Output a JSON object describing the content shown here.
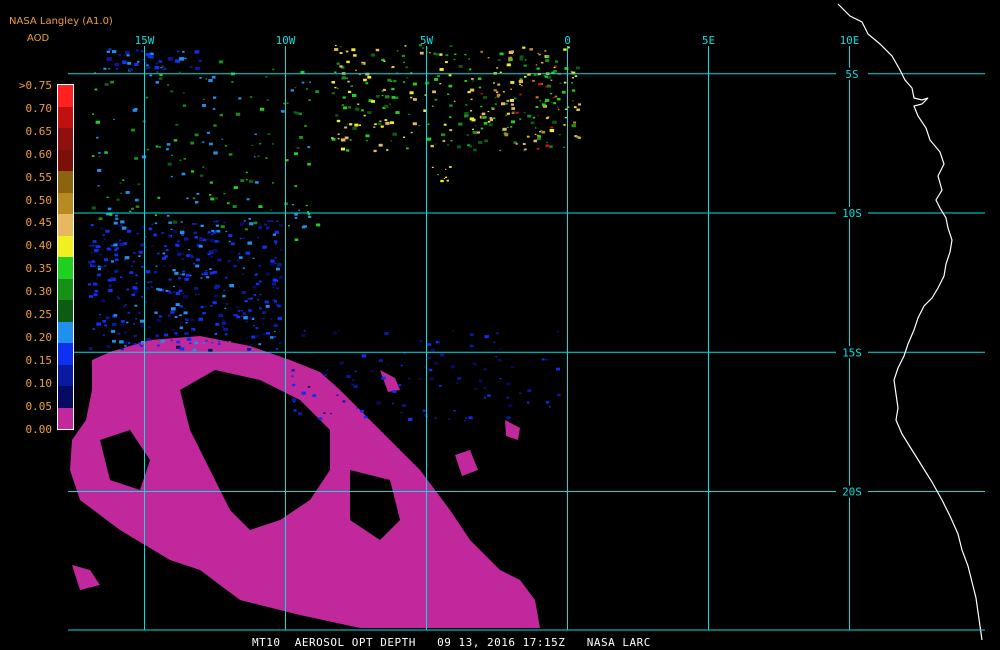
{
  "header": {
    "title": "NASA Langley (A1.0)",
    "variable": "AOD"
  },
  "legend": [
    {
      "label": ">0.75",
      "color": "#ff2020"
    },
    {
      "label": "0.70",
      "color": "#c01010"
    },
    {
      "label": "0.65",
      "color": "#901010"
    },
    {
      "label": "0.60",
      "color": "#7a1008"
    },
    {
      "label": "0.55",
      "color": "#8c6410"
    },
    {
      "label": "0.50",
      "color": "#b88a20"
    },
    {
      "label": "0.45",
      "color": "#e8b860"
    },
    {
      "label": "0.40",
      "color": "#f0f020"
    },
    {
      "label": "0.35",
      "color": "#20d020"
    },
    {
      "label": "0.30",
      "color": "#169016"
    },
    {
      "label": "0.25",
      "color": "#0c5c14"
    },
    {
      "label": "0.20",
      "color": "#2090f0"
    },
    {
      "label": "0.15",
      "color": "#1030f0"
    },
    {
      "label": "0.10",
      "color": "#0a1aa0"
    },
    {
      "label": "0.05",
      "color": "#060a60"
    },
    {
      "label": "0.00",
      "color": "#c0289c"
    }
  ],
  "map": {
    "gridline_color": "#00e0e0",
    "coastline_color": "#ffffff",
    "longitudes": [
      {
        "label": "15W",
        "value": -15
      },
      {
        "label": "10W",
        "value": -10
      },
      {
        "label": "5W",
        "value": -5
      },
      {
        "label": "0",
        "value": 0
      },
      {
        "label": "5E",
        "value": 5
      },
      {
        "label": "10E",
        "value": 10
      }
    ],
    "latitudes": [
      {
        "label": "5S",
        "value": -5
      },
      {
        "label": "10S",
        "value": -10
      },
      {
        "label": "15S",
        "value": -15
      },
      {
        "label": "20S",
        "value": -20
      }
    ]
  },
  "footer": "MT10  AEROSOL OPT DEPTH   09 13, 2016 17:15Z   NASA LARC"
}
